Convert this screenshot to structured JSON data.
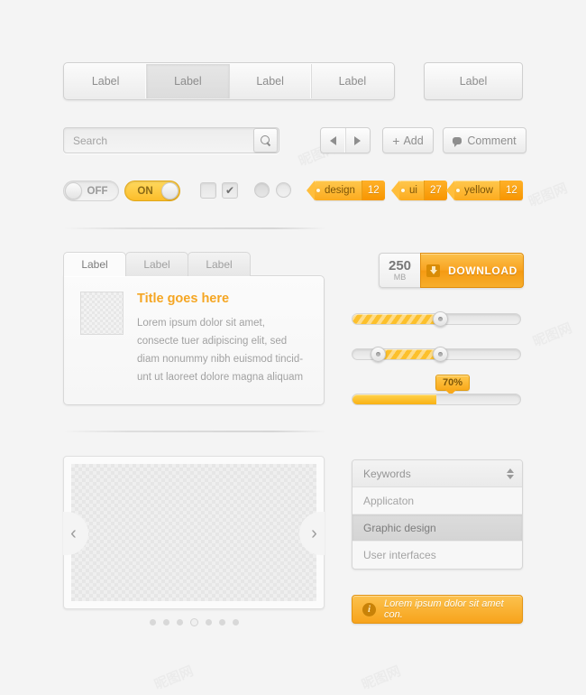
{
  "segmented": {
    "items": [
      {
        "label": "Label",
        "active": false
      },
      {
        "label": "Label",
        "active": true
      },
      {
        "label": "Label",
        "active": false
      },
      {
        "label": "Label",
        "active": false
      }
    ],
    "standalone_label": "Label"
  },
  "search": {
    "placeholder": "Search",
    "value": "",
    "icon": "search-icon"
  },
  "actions": {
    "prev_icon": "triangle-left-icon",
    "next_icon": "triangle-right-icon",
    "add_label": "Add",
    "add_icon": "plus-icon",
    "comment_label": "Comment",
    "comment_icon": "speech-bubble-icon"
  },
  "toggles": {
    "off_label": "OFF",
    "on_label": "ON"
  },
  "checkbox": {
    "check_glyph": "✔"
  },
  "tags": [
    {
      "name": "design",
      "count": "12"
    },
    {
      "name": "ui",
      "count": "27"
    },
    {
      "name": "yellow",
      "count": "12"
    }
  ],
  "tab_panel": {
    "tabs": [
      {
        "label": "Label",
        "active": true
      },
      {
        "label": "Label",
        "active": false
      },
      {
        "label": "Label",
        "active": false
      }
    ],
    "title": "Title goes here",
    "body": "Lorem ipsum dolor sit amet, consecte tuer adipiscing elit, sed diam nonummy nibh euismod tincid-unt ut laoreet dolore magna aliquam"
  },
  "download": {
    "size_value": "250",
    "size_unit": "MB",
    "button_label": "DOWNLOAD",
    "icon": "download-icon"
  },
  "sliders": [
    {
      "name": "single-slider",
      "fill_percent": 52,
      "handles": [
        52
      ]
    },
    {
      "name": "range-slider",
      "fill_start": 15,
      "fill_end": 52,
      "handles": [
        15,
        52
      ]
    },
    {
      "name": "progress-slider",
      "fill_percent": 50,
      "tooltip": "70%"
    }
  ],
  "carousel": {
    "prev_icon": "chevron-left-icon",
    "next_icon": "chevron-right-icon",
    "prev_glyph": "‹",
    "next_glyph": "›",
    "dot_count": 7,
    "active_dot": 3
  },
  "listbox": {
    "header": "Keywords",
    "spinner_icon": "spinner-up-down-icon",
    "options": [
      {
        "label": "Applicaton",
        "selected": false
      },
      {
        "label": "Graphic design",
        "selected": true
      },
      {
        "label": "User interfaces",
        "selected": false
      }
    ]
  },
  "alert": {
    "icon": "info-icon",
    "icon_glyph": "i",
    "text": "Lorem ipsum dolor sit amet con."
  },
  "colors": {
    "accent": "#f9a91b",
    "accent_light": "#fcc24e",
    "page_bg": "#f4f4f4",
    "text_muted": "#a0a0a0"
  },
  "watermarks": [
    "昵图网",
    "昵图网",
    "昵图网",
    "昵图网",
    "昵图网",
    "昵图网"
  ]
}
